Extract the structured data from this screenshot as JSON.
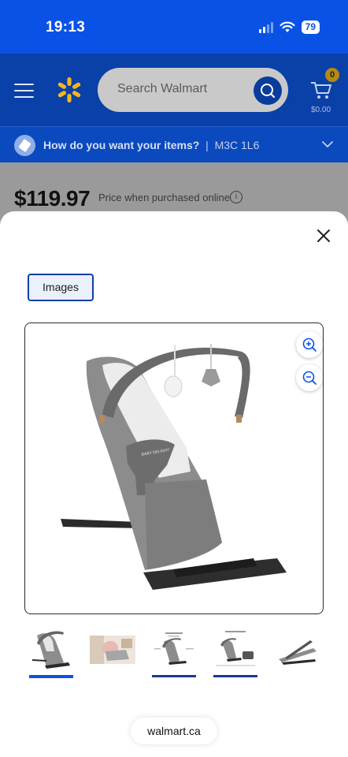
{
  "status_bar": {
    "time": "19:13",
    "battery": "79"
  },
  "header": {
    "search_placeholder": "Search Walmart",
    "cart_count": "0",
    "cart_total": "$0.00"
  },
  "delivery": {
    "question": "How do you want your items?",
    "separator": "|",
    "postal_code": "M3C 1L6"
  },
  "product": {
    "price": "$119.97",
    "price_note": "Price when purchased online",
    "info_glyph": "i"
  },
  "modal": {
    "tab_label": "Images",
    "thumbnails": [
      {
        "name": "bouncer-front-angle",
        "active": true
      },
      {
        "name": "baby-in-bouncer",
        "active": false
      },
      {
        "name": "bouncer-feature-diagram",
        "active": false
      },
      {
        "name": "bouncer-dimensions-diagram",
        "active": false
      },
      {
        "name": "bouncer-folded",
        "active": false
      }
    ]
  },
  "footer": {
    "url": "walmart.ca"
  },
  "colors": {
    "status_blue": "#0a52e6",
    "header_blue": "#0a41a8",
    "delivery_blue": "#0b49bf",
    "spark_yellow": "#f7b51b",
    "active_indicator": "#0a52e6"
  },
  "icons": {
    "menu": "hamburger-icon",
    "logo": "walmart-spark-icon",
    "search": "search-icon",
    "cart": "cart-icon",
    "delivery": "delivery-icon",
    "chevron": "chevron-down-icon",
    "info": "info-icon",
    "close": "close-icon",
    "zoom_in": "zoom-in-icon",
    "zoom_out": "zoom-out-icon"
  }
}
